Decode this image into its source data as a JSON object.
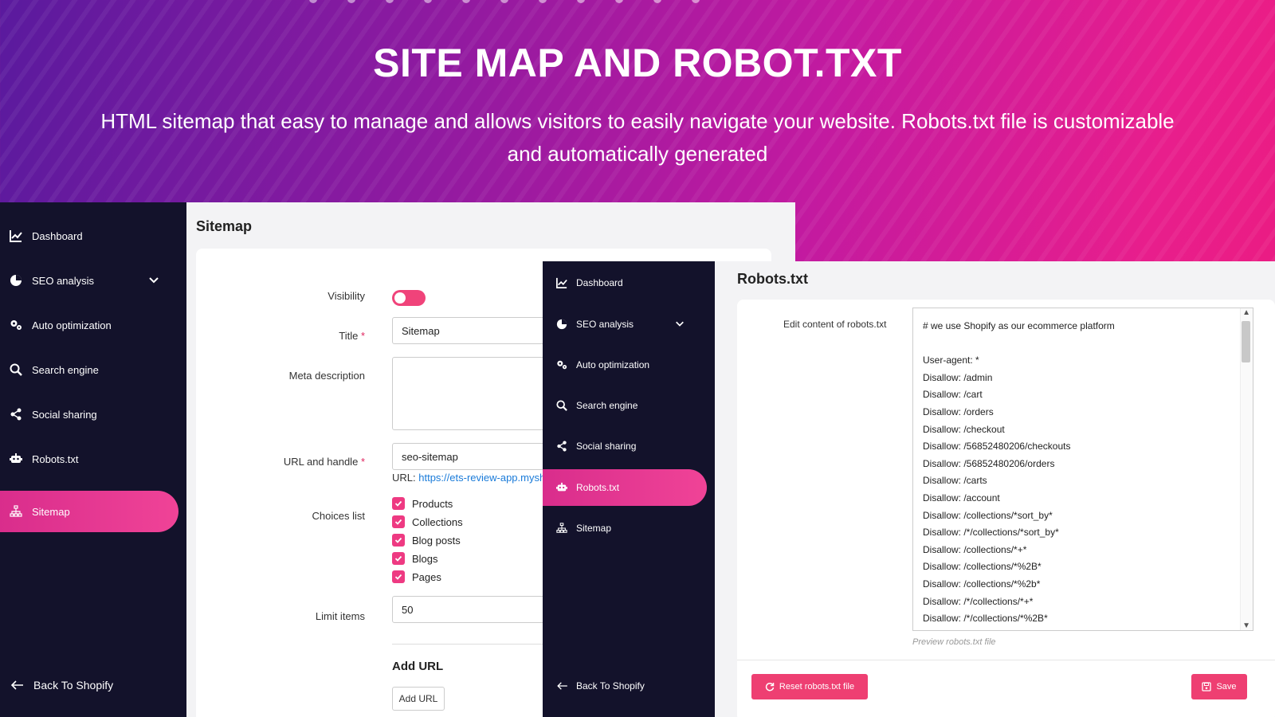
{
  "hero": {
    "title": "SITE MAP AND ROBOT.TXT",
    "subtitle": "HTML sitemap that easy to manage and allows visitors to easily navigate your website. Robots.txt file is customizable and automatically generated"
  },
  "colors": {
    "accent": "#ee3f72",
    "sidebar_bg": "#13122b",
    "link": "#1a7bd9"
  },
  "sidebar": {
    "items": [
      {
        "label": "Dashboard",
        "icon": "chart-icon"
      },
      {
        "label": "SEO analysis",
        "icon": "pie-chart-icon"
      },
      {
        "label": "Auto optimization",
        "icon": "gears-icon"
      },
      {
        "label": "Search engine",
        "icon": "search-icon"
      },
      {
        "label": "Social sharing",
        "icon": "share-icon"
      },
      {
        "label": "Robots.txt",
        "icon": "robot-icon"
      },
      {
        "label": "Sitemap",
        "icon": "sitemap-icon"
      }
    ],
    "back_label": "Back To Shopify"
  },
  "sitemap_page": {
    "title": "Sitemap",
    "visibility_label": "Visibility",
    "title_label": "Title",
    "title_value": "Sitemap",
    "meta_label": "Meta description",
    "url_label": "URL and handle",
    "url_value": "seo-sitemap",
    "url_prefix": "URL:",
    "url_link": "https://ets-review-app.mysh",
    "choices_label": "Choices list",
    "choices": [
      "Products",
      "Collections",
      "Blog posts",
      "Blogs",
      "Pages"
    ],
    "limit_label": "Limit items",
    "limit_value": "50",
    "add_url_title": "Add URL",
    "add_url_button": "Add URL"
  },
  "robots_page": {
    "title": "Robots.txt",
    "edit_label": "Edit content of robots.txt",
    "content": "# we use Shopify as our ecommerce platform\n\nUser-agent: *\nDisallow: /admin\nDisallow: /cart\nDisallow: /orders\nDisallow: /checkout\nDisallow: /56852480206/checkouts\nDisallow: /56852480206/orders\nDisallow: /carts\nDisallow: /account\nDisallow: /collections/*sort_by*\nDisallow: /*/collections/*sort_by*\nDisallow: /collections/*+*\nDisallow: /collections/*%2B*\nDisallow: /collections/*%2b*\nDisallow: /*/collections/*+*\nDisallow: /*/collections/*%2B*",
    "preview_link": "Preview robots.txt file",
    "reset_button": "Reset robots.txt file",
    "save_button": "Save"
  }
}
